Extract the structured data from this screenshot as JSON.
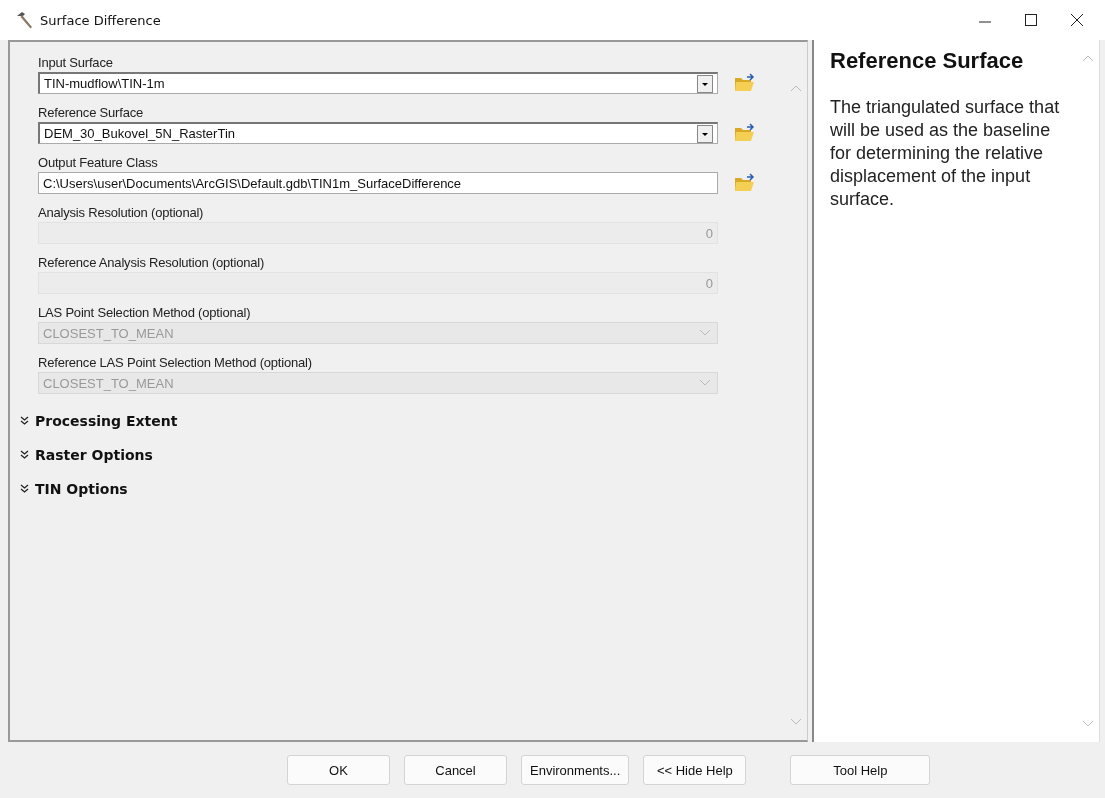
{
  "window": {
    "title": "Surface Difference"
  },
  "parameters": [
    {
      "label": "Input Surface",
      "kind": "dropdown",
      "value": "TIN-mudflow\\TIN-1m",
      "disabled": false
    },
    {
      "label": "Reference Surface",
      "kind": "dropdown",
      "value": "DEM_30_Bukovel_5N_RasterTin",
      "disabled": false
    },
    {
      "label": "Output Feature Class",
      "kind": "text",
      "value": "C:\\Users\\user\\Documents\\ArcGIS\\Default.gdb\\TIN1m_SurfaceDifference",
      "disabled": false
    },
    {
      "label": "Analysis Resolution (optional)",
      "kind": "number",
      "value": "0",
      "disabled": true
    },
    {
      "label": "Reference Analysis Resolution (optional)",
      "kind": "number",
      "value": "0",
      "disabled": true
    },
    {
      "label": "LAS Point Selection Method (optional)",
      "kind": "select",
      "value": "CLOSEST_TO_MEAN",
      "disabled": true
    },
    {
      "label": "Reference LAS Point Selection Method (optional)",
      "kind": "select",
      "value": "CLOSEST_TO_MEAN",
      "disabled": true
    }
  ],
  "sections": [
    {
      "label": "Processing Extent",
      "expanded": false
    },
    {
      "label": "Raster Options",
      "expanded": false
    },
    {
      "label": "TIN Options",
      "expanded": false
    }
  ],
  "help": {
    "title": "Reference Surface",
    "text": "The triangulated surface that will be used as the baseline for determining the relative displacement of the input surface."
  },
  "buttons": [
    {
      "label": "OK",
      "kind": "action"
    },
    {
      "label": "Cancel",
      "kind": "action"
    },
    {
      "label": "Environments...",
      "kind": "action"
    },
    {
      "label": "<< Hide Help",
      "kind": "action"
    },
    {
      "label": "Tool Help",
      "kind": "separate"
    }
  ]
}
